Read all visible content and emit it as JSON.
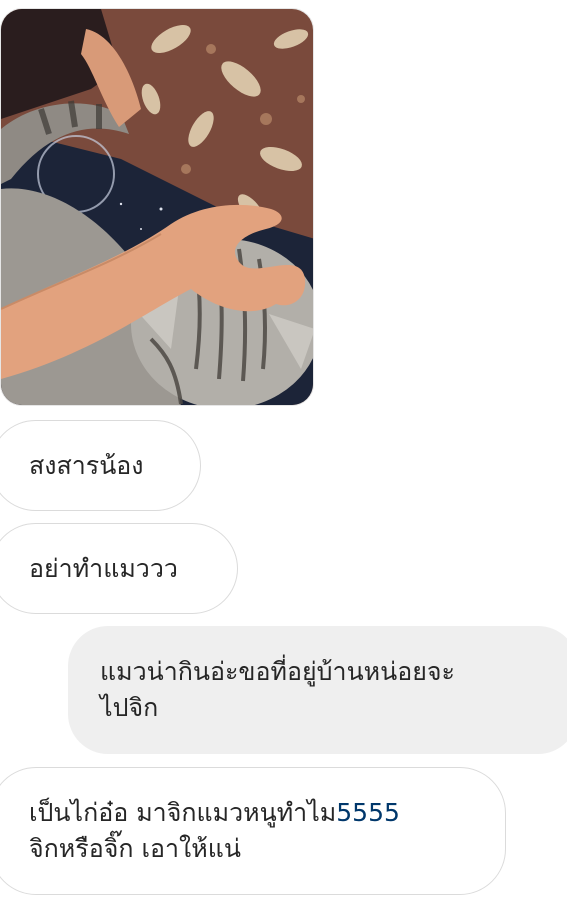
{
  "photo": {
    "icon": "photo-message-icon",
    "palette": {
      "blanket": "#7a4a3c",
      "leaf": "#e8d8b8",
      "navy": "#1c2438",
      "fur": "#a9a6a0",
      "stripe": "#4e4a45",
      "skin": "#e2a27e",
      "sleeve": "#2a1d1e"
    }
  },
  "messages": [
    {
      "direction": "incoming",
      "lines": [
        "สงสารน้อง"
      ]
    },
    {
      "direction": "incoming",
      "lines": [
        "อย่าทำแมววว"
      ]
    },
    {
      "direction": "outgoing",
      "lines": [
        "แมวน่ากินอ่ะขอที่อยู่บ้านหน่อยจะ",
        "ไปจิก"
      ]
    },
    {
      "direction": "incoming",
      "line1_text": "เป็นไก่อ๋อ มาจิกแมวหนูทำไม",
      "line1_link": "5555",
      "line2": "จิกหรือจิ๊ก เอาให้แน่"
    }
  ],
  "colors": {
    "incoming_border": "#dbdbdb",
    "outgoing_bg": "#efefef",
    "text": "#262626",
    "link": "#00376b"
  }
}
